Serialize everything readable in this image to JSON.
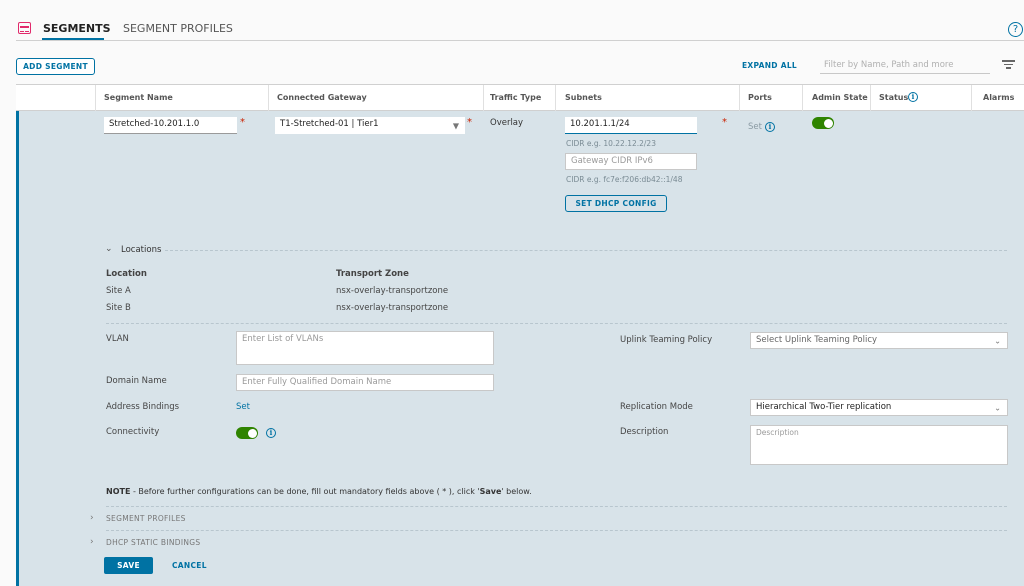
{
  "tabs": [
    {
      "label": "SEGMENTS",
      "active": true
    },
    {
      "label": "SEGMENT PROFILES",
      "active": false
    }
  ],
  "help_icon": "?",
  "toolbar": {
    "add_segment": "ADD SEGMENT",
    "expand_all": "EXPAND ALL",
    "filter_placeholder": "Filter by Name, Path and more"
  },
  "table": {
    "headers": {
      "segment_name": "Segment Name",
      "connected_gateway": "Connected Gateway",
      "traffic_type": "Traffic Type",
      "subnets": "Subnets",
      "ports": "Ports",
      "admin_state": "Admin State",
      "status": "Status",
      "alarms": "Alarms"
    }
  },
  "row": {
    "segment_name": "Stretched-10.201.1.0",
    "connected_gateway": "T1-Stretched-01 | Tier1",
    "traffic_type": "Overlay",
    "subnet_value": "10.201.1.1/24",
    "subnet_hint": "CIDR e.g. 10.22.12.2/23",
    "ipv6_placeholder": "Gateway CIDR IPv6",
    "ipv6_hint": "CIDR e.g. fc7e:f206:db42::1/48",
    "set_dhcp": "SET DHCP CONFIG",
    "ports_set": "Set",
    "required_mark": "*",
    "admin_state_on": true
  },
  "locations": {
    "title": "Locations",
    "col_location": "Location",
    "col_transport_zone": "Transport Zone",
    "rows": [
      {
        "location": "Site A",
        "zone": "nsx-overlay-transportzone"
      },
      {
        "location": "Site B",
        "zone": "nsx-overlay-transportzone"
      }
    ]
  },
  "form": {
    "vlan_label": "VLAN",
    "vlan_placeholder": "Enter List of VLANs",
    "uplink_label": "Uplink Teaming Policy",
    "uplink_placeholder": "Select Uplink Teaming Policy",
    "domain_label": "Domain Name",
    "domain_placeholder": "Enter Fully Qualified Domain Name",
    "address_label": "Address Bindings",
    "address_set": "Set",
    "replication_label": "Replication Mode",
    "replication_value": "Hierarchical Two-Tier replication",
    "connectivity_label": "Connectivity",
    "description_label": "Description",
    "description_placeholder": "Description"
  },
  "note": {
    "bold": "NOTE",
    "text1": " - Before further configurations can be done, fill out mandatory fields above ( * ), click '",
    "save_word": "Save",
    "text2": "' below."
  },
  "sections": {
    "segment_profiles": "SEGMENT PROFILES",
    "dhcp_static": "DHCP STATIC BINDINGS"
  },
  "actions": {
    "save": "SAVE",
    "cancel": "CANCEL"
  },
  "colors": {
    "accent": "#0072a3",
    "row_bg": "#d8e3e9",
    "toggle_on": "#2f8400",
    "required": "#c92100",
    "icon_pink": "#e12a6b"
  }
}
